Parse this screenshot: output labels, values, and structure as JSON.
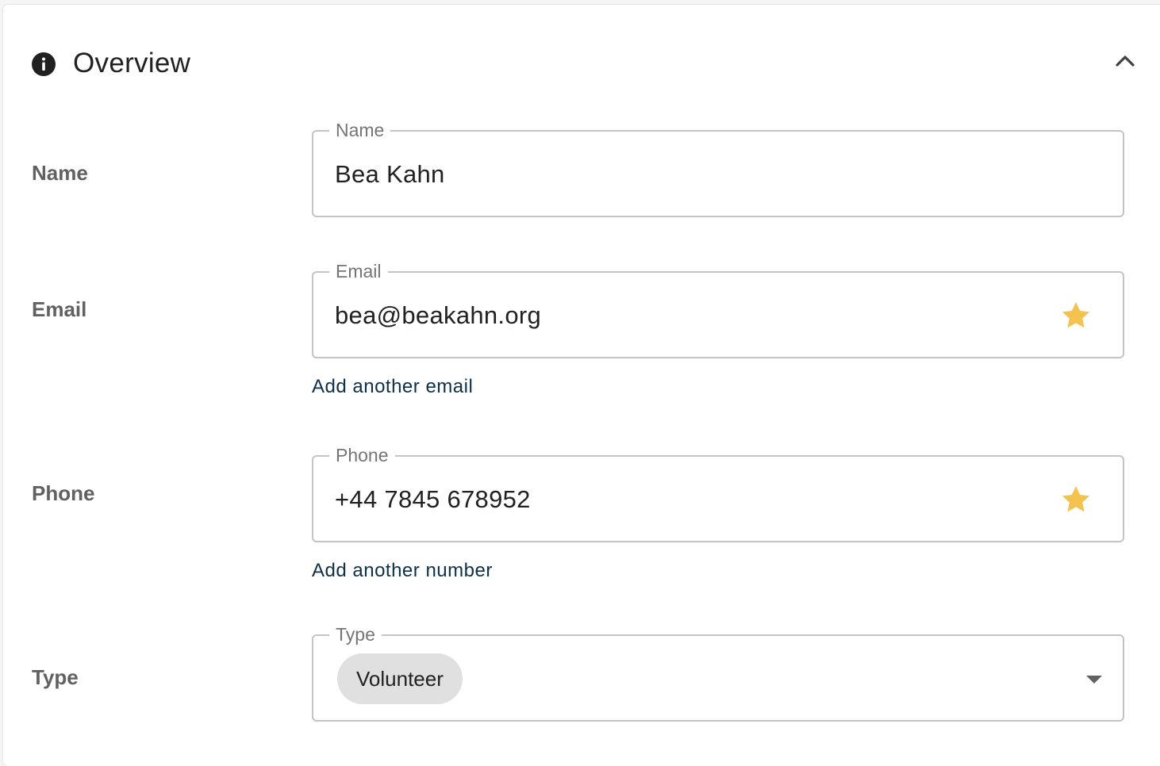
{
  "section": {
    "title": "Overview",
    "info_icon": "info-icon",
    "collapse_icon": "chevron-up-icon"
  },
  "fields": {
    "name": {
      "row_label": "Name",
      "legend": "Name",
      "value": "Bea Kahn"
    },
    "email": {
      "row_label": "Email",
      "legend": "Email",
      "value": "bea@beakahn.org",
      "primary_icon": "star-icon",
      "add_link": "Add another email"
    },
    "phone": {
      "row_label": "Phone",
      "legend": "Phone",
      "value": "+44 7845 678952",
      "primary_icon": "star-icon",
      "add_link": "Add another number"
    },
    "type": {
      "row_label": "Type",
      "legend": "Type",
      "selected_chip": "Volunteer",
      "dropdown_icon": "caret-down-icon"
    }
  },
  "colors": {
    "star": "#F4C24F",
    "link": "#0D3048",
    "label": "#616161",
    "border": "#C4C4C4",
    "chip_bg": "#E0E0E0"
  }
}
